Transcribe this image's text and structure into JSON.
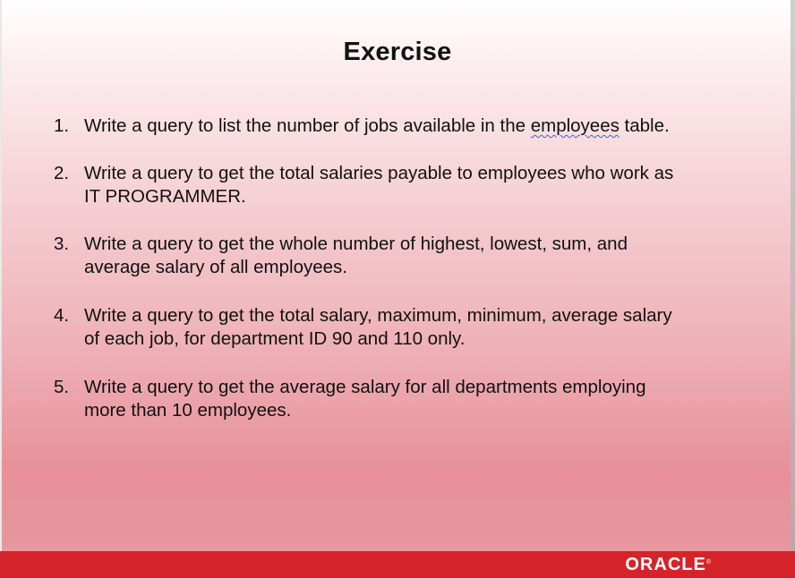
{
  "slide": {
    "title": "Exercise",
    "items": [
      {
        "number": "1.",
        "text_before": "Write a query to list the number of jobs available in the ",
        "highlight": "employees",
        "text_after": " table."
      },
      {
        "number": "2.",
        "line1": "Write a query to get the total salaries payable to employees who work as",
        "line2": "IT PROGRAMMER."
      },
      {
        "number": "3.",
        "line1": "Write a query to get the whole number of highest, lowest, sum, and",
        "line2": "average salary of all employees."
      },
      {
        "number": "4.",
        "line1": "Write a query to get the total salary, maximum, minimum, average salary",
        "line2": "of each job, for department ID 90 and 110 only."
      },
      {
        "number": "5.",
        "line1": "Write a query to get the average salary for all departments employing",
        "line2": "more than 10 employees."
      }
    ]
  },
  "footer": {
    "logo_text": "ORACLE",
    "logo_mark": "®"
  },
  "colors": {
    "footer_bar": "#d5232a",
    "spellcheck_underline": "#3a62d6"
  }
}
